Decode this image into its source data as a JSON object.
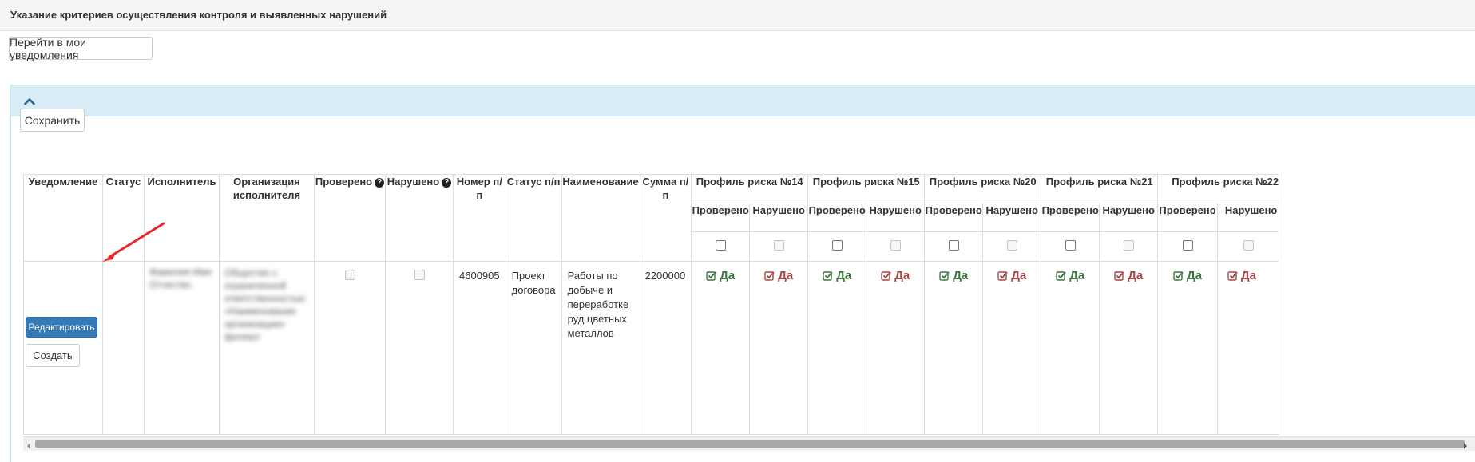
{
  "page": {
    "title": "Указание критериев осуществления контроля и выявленных нарушений",
    "go_notifications_label": "Перейти в мои уведомления",
    "save_label": "Сохранить",
    "panel_toggle_icon": "chevron-up-icon"
  },
  "table": {
    "headers": {
      "notification": "Уведомление",
      "status": "Статус",
      "executor": "Исполнитель",
      "executor_org": "Организация исполнителя",
      "checked": "Проверено",
      "violated": "Нарушено",
      "number": "Номер п/п",
      "status_pp": "Статус п/п",
      "name": "Наименование",
      "sum": "Сумма п/п"
    },
    "help_icon": "question-circle-icon",
    "risk_profiles": [
      {
        "title": "Профиль риска №14",
        "checked_label": "Проверено",
        "violated_label": "Нарушено",
        "checked_value": "Да",
        "violated_value": "Да"
      },
      {
        "title": "Профиль риска №15",
        "checked_label": "Проверено",
        "violated_label": "Нарушено",
        "checked_value": "Да",
        "violated_value": "Да"
      },
      {
        "title": "Профиль риска №20",
        "checked_label": "Проверено",
        "violated_label": "Нарушено",
        "checked_value": "Да",
        "violated_value": "Да"
      },
      {
        "title": "Профиль риска №21",
        "checked_label": "Проверено",
        "violated_label": "Нарушено",
        "checked_value": "Да",
        "violated_value": "Да"
      },
      {
        "title": "Профиль риска №22",
        "checked_label": "Проверено",
        "violated_label": "Нарушено",
        "checked_value": "Да",
        "violated_value": "Да"
      }
    ],
    "row": {
      "edit_label": "Редактировать",
      "create_label": "Создать",
      "number": "4600905",
      "status_pp": "Проект договора",
      "name": "Работы по добыче и переработке руд цветных металлов",
      "sum": "2200000",
      "executor_blurred": "Фамилия Имя Отчество",
      "org_blurred": "Общество с ограниченной ответственностью «Наименование организации» филиал"
    }
  },
  "colors": {
    "primary": "#337ab7",
    "yes_green": "#3c763d",
    "yes_red": "#a94442",
    "panel_head": "#d9edf7",
    "arrow": "#e8262b"
  },
  "annotations": {
    "arrow": "red-arrow-pointing-to-edit-button"
  }
}
